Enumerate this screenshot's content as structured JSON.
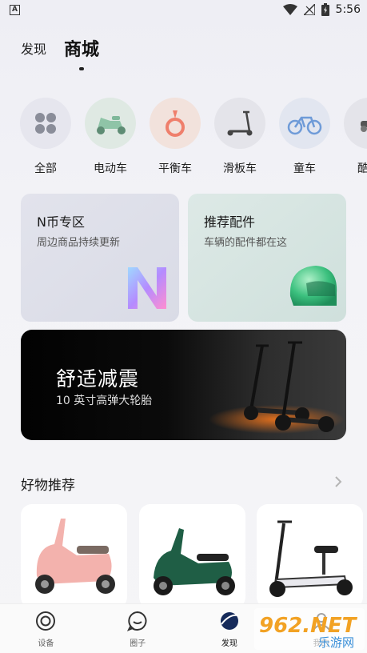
{
  "status_bar": {
    "time": "5:56",
    "app_letter": "A"
  },
  "top_tabs": [
    {
      "label": "发现"
    },
    {
      "label": "商城"
    }
  ],
  "categories": [
    {
      "label": "全部",
      "icon": "grid-icon"
    },
    {
      "label": "电动车",
      "icon": "scooter-icon"
    },
    {
      "label": "平衡车",
      "icon": "balance-wheel-icon"
    },
    {
      "label": "滑板车",
      "icon": "kick-scooter-icon"
    },
    {
      "label": "童车",
      "icon": "kids-bike-icon"
    },
    {
      "label": "酷",
      "icon": "cool-vehicle-icon"
    }
  ],
  "cards": {
    "n_coin": {
      "title": "N币专区",
      "subtitle": "周边商品持续更新"
    },
    "parts": {
      "title": "推荐配件",
      "subtitle": "车辆的配件都在这"
    }
  },
  "banner": {
    "title": "舒适减震",
    "subtitle": "10 英寸高弹大轮胎"
  },
  "recommend": {
    "title": "好物推荐",
    "more_icon": "chevron-right-icon"
  },
  "products": [
    {
      "name": "pink-scooter"
    },
    {
      "name": "green-scooter"
    },
    {
      "name": "seated-kick-scooter"
    }
  ],
  "bottom_nav": [
    {
      "label": "设备",
      "icon": "device-icon"
    },
    {
      "label": "圈子",
      "icon": "community-icon"
    },
    {
      "label": "发现",
      "icon": "discover-icon"
    },
    {
      "label": "我的",
      "icon": "profile-icon"
    }
  ],
  "watermark": {
    "brand": "962.NET",
    "sub": "乐游网"
  },
  "colors": {
    "accent": "#111111",
    "pink": "#f3b2ad",
    "green": "#1f5e45"
  }
}
